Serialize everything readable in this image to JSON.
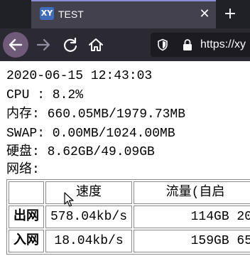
{
  "browser": {
    "tab": {
      "favicon_text": "XY",
      "title": "TEST"
    },
    "new_tab_glyph": "+",
    "close_glyph": "✕",
    "url": "https://xy"
  },
  "info": {
    "datetime": "2020-06-15 12:43:03",
    "cpu": "CPU : 8.2%",
    "memory": "内存: 660.05MB/1979.73MB",
    "swap": "SWAP: 0.00MB/1024.00MB",
    "disk": "硬盘: 8.62GB/49.09GB",
    "network_label": "网络:"
  },
  "network_table": {
    "headers": {
      "speed": "速度",
      "traffic": "流量(自启"
    },
    "rows": [
      {
        "label": "出网",
        "speed": "578.04kb/s",
        "traffic": "114GB 20"
      },
      {
        "label": "入网",
        "speed": "18.04kb/s",
        "traffic": "159GB 65"
      }
    ]
  },
  "colors": {
    "tabstrip_bg": "#202126",
    "active_tab_bg": "#42414d",
    "toolbar_bg": "#2b2a33",
    "urlbar_bg": "#1c1b22",
    "back_button_highlight": "#6f5b79",
    "favicon_bg": "#3f6dbb"
  }
}
